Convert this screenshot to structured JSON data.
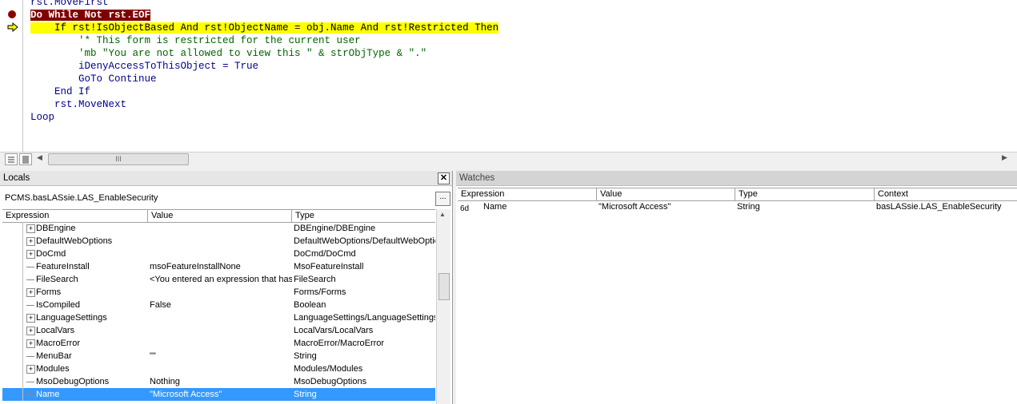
{
  "code": {
    "lines": [
      {
        "text": "rst.MoveFirst",
        "style": "normal"
      },
      {
        "text": "Do While Not rst.EOF",
        "style": "break"
      },
      {
        "text": "    If rst!IsObjectBased And rst!ObjectName = obj.Name And rst!Restricted Then",
        "style": "exec"
      },
      {
        "text": "        '* This form is restricted for the current user",
        "style": "comment"
      },
      {
        "text": "        'mb \"You are not allowed to view this \" & strObjType & \".\"",
        "style": "comment"
      },
      {
        "text": "        iDenyAccessToThisObject = True",
        "style": "normal"
      },
      {
        "text": "        GoTo Continue",
        "style": "normal"
      },
      {
        "text": "    End If",
        "style": "normal"
      },
      {
        "text": "    rst.MoveNext",
        "style": "normal"
      },
      {
        "text": "Loop",
        "style": "normal"
      }
    ],
    "breakpoint_color": "#8b0000",
    "exec_color": "#ffff00"
  },
  "hscroll": {
    "thumb_label": "III"
  },
  "locals": {
    "title": "Locals",
    "close_label": "✕",
    "context": "PCMS.basLASsie.LAS_EnableSecurity",
    "call_stack_label": "...",
    "columns": {
      "expression": "Expression",
      "value": "Value",
      "type": "Type"
    },
    "rows": [
      {
        "name": "DBEngine",
        "value": "",
        "type": "DBEngine/DBEngine",
        "expandable": true
      },
      {
        "name": "DefaultWebOptions",
        "value": "",
        "type": "DefaultWebOptions/DefaultWebOptio",
        "expandable": true
      },
      {
        "name": "DoCmd",
        "value": "",
        "type": "DoCmd/DoCmd",
        "expandable": true
      },
      {
        "name": "FeatureInstall",
        "value": "msoFeatureInstallNone",
        "type": "MsoFeatureInstall",
        "expandable": false
      },
      {
        "name": "FileSearch",
        "value": "<You entered an expression that has",
        "type": "FileSearch",
        "expandable": false
      },
      {
        "name": "Forms",
        "value": "",
        "type": "Forms/Forms",
        "expandable": true
      },
      {
        "name": "IsCompiled",
        "value": "False",
        "type": "Boolean",
        "expandable": false
      },
      {
        "name": "LanguageSettings",
        "value": "",
        "type": "LanguageSettings/LanguageSettings",
        "expandable": true
      },
      {
        "name": "LocalVars",
        "value": "",
        "type": "LocalVars/LocalVars",
        "expandable": true
      },
      {
        "name": "MacroError",
        "value": "",
        "type": "MacroError/MacroError",
        "expandable": true
      },
      {
        "name": "MenuBar",
        "value": "\"\"",
        "type": "String",
        "expandable": false
      },
      {
        "name": "Modules",
        "value": "",
        "type": "Modules/Modules",
        "expandable": true
      },
      {
        "name": "MsoDebugOptions",
        "value": "Nothing",
        "type": "MsoDebugOptions",
        "expandable": false
      },
      {
        "name": "Name",
        "value": "\"Microsoft Access\"",
        "type": "String",
        "expandable": false,
        "selected": true
      }
    ]
  },
  "watches": {
    "title": "Watches",
    "columns": {
      "expression": "Expression",
      "value": "Value",
      "type": "Type",
      "context": "Context"
    },
    "rows": [
      {
        "icon": "glasses-icon",
        "name": "Name",
        "value": "\"Microsoft Access\"",
        "type": "String",
        "context": "basLASsie.LAS_EnableSecurity"
      }
    ]
  },
  "colors": {
    "selection": "#3399ff",
    "keyword": "#00008b"
  }
}
